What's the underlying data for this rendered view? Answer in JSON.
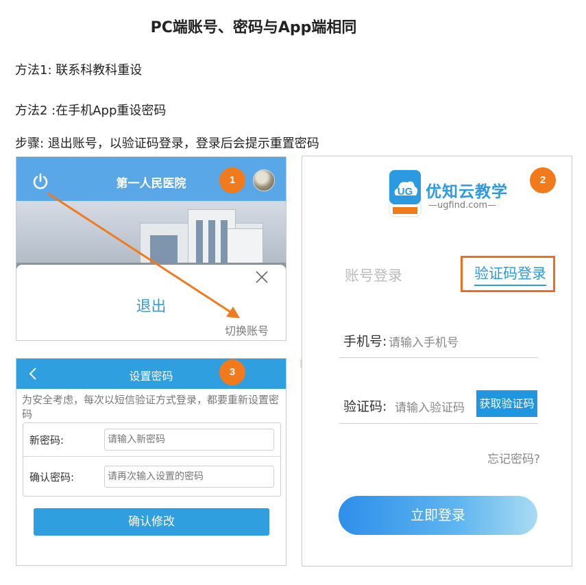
{
  "title": "PC端账号、密码与App端相同",
  "method1": "方法1: 联系科教科重设",
  "method2": "方法2 :在手机App重设密码",
  "steps": "步骤: 退出账号，以验证码登录，登录后会提示重置密码",
  "colors": {
    "accent_blue": "#2f9fe0",
    "badge_orange": "#f07a1c",
    "highlight_orange": "#ef6d1c"
  },
  "panel1": {
    "header_title": "第一人民医院",
    "badge": "1",
    "logout_label": "退出",
    "switch_account": "切换账号",
    "icons": [
      "power-icon",
      "avatar",
      "close-icon"
    ]
  },
  "panel2": {
    "badge": "2",
    "brand_name": "优知云教学",
    "domain": "—ugfind.com—",
    "tab_account_login": "账号登录",
    "tab_code_login": "验证码登录",
    "phone_label": "手机号:",
    "phone_placeholder": "请输入手机号",
    "code_label": "验证码:",
    "code_placeholder": "请输入验证码",
    "get_code": "获取验证码",
    "forgot_password": "忘记密码?",
    "login_button": "立即登录"
  },
  "panel3": {
    "badge": "3",
    "header_title": "设置密码",
    "notice": "为安全考虑，每次以短信验证方式登录，都要重新设置密码",
    "new_password_label": "新密码:",
    "new_password_placeholder": "请输入新密码",
    "confirm_password_label": "确认密码:",
    "confirm_password_placeholder": "请再次输入设置的密码",
    "submit": "确认修改"
  }
}
